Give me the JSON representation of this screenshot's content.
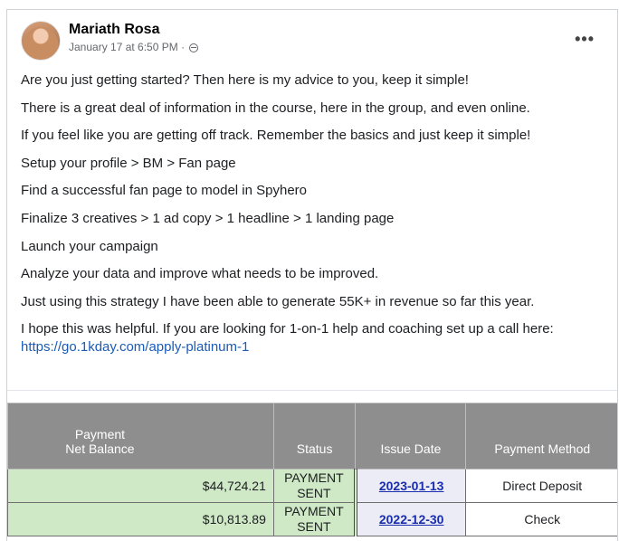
{
  "post": {
    "author": "Mariath Rosa",
    "timestamp": "January 17 at 6:50 PM · ",
    "privacy_icon": "globe-icon",
    "more_label": "•••",
    "paragraphs": [
      "Are you just getting started? Then here is my advice to you, keep it simple!",
      "There is a great deal of information in the course, here in the group, and even online.",
      "If you feel like you are getting off track. Remember the basics and just keep it simple!",
      "Setup your profile > BM > Fan page",
      "Find a successful fan page to model in Spyhero",
      "Finalize 3 creatives > 1 ad copy > 1 headline > 1 landing page",
      "Launch your campaign",
      "Analyze your data and improve what needs to be improved.",
      "Just using this strategy I have been able to generate 55K+ in revenue so far this year."
    ],
    "closing_text": "I hope this was helpful. If you are looking for 1-on-1 help and coaching set up a call here:",
    "link": "https://go.1kday.com/apply-platinum-1"
  },
  "payments": {
    "headers": {
      "payment": "Payment",
      "net_balance": "Net Balance",
      "status": "Status",
      "issue_date": "Issue Date",
      "method": "Payment Method"
    },
    "rows": [
      {
        "amount": "$44,724.21",
        "status_line1": "PAYMENT",
        "status_line2": "SENT",
        "date": "2023-01-13",
        "method": "Direct Deposit"
      },
      {
        "amount": "$10,813.89",
        "status_line1": "PAYMENT",
        "status_line2": "SENT",
        "date": "2022-12-30",
        "method": "Check"
      }
    ]
  }
}
